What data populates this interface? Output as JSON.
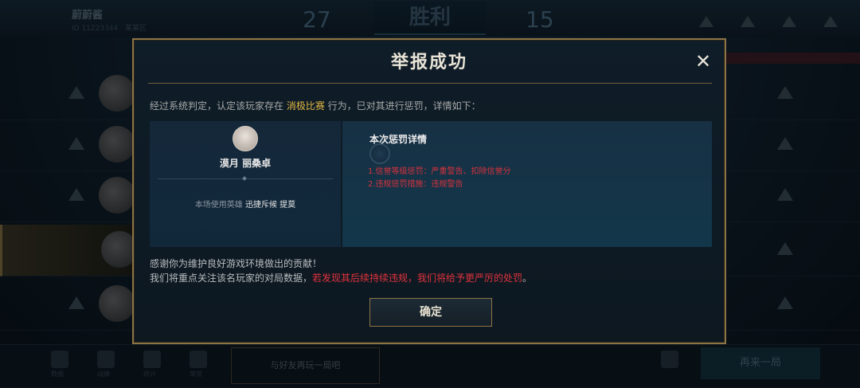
{
  "background": {
    "player_name": "蔚蔚酱",
    "player_sub": "ID 11223344 · 某某区",
    "score_left": "27",
    "score_right": "15",
    "result": "胜利",
    "bottom_button": "与好友再玩一局吧",
    "bottom_right_button": "再来一局",
    "bottom_labels": [
      "数据",
      "战绩",
      "统计",
      "荣誉"
    ]
  },
  "dialog": {
    "title": "举报成功",
    "close_icon": "✕",
    "verdict_prefix": "经过系统判定，认定该玩家存在 ",
    "verdict_behavior": "消极比赛",
    "verdict_suffix": " 行为，已对其进行惩罚，详情如下：",
    "player": {
      "name": "漠月 丽桑卓",
      "hero_prefix": "本场使用英雄 ",
      "hero_name": "迅捷斥候 提莫"
    },
    "detail": {
      "title": "本次惩罚详情",
      "items": [
        "1.信誉等级惩罚：严重警告、扣除信誉分",
        "2.违规惩罚措施：违规警告"
      ]
    },
    "thanks_line1": "感谢你为维护良好游戏环境做出的贡献！",
    "thanks_line2_prefix": "我们将重点关注该名玩家的对局数据，",
    "thanks_line2_warn": "若发现其后续持续违规，我们将给予更严厉的处罚",
    "thanks_line2_end": "。",
    "confirm_label": "确定"
  },
  "colors": {
    "accent_gold": "#e3b744",
    "warning_red": "#e0323d",
    "border_gold": "#8c7446"
  }
}
